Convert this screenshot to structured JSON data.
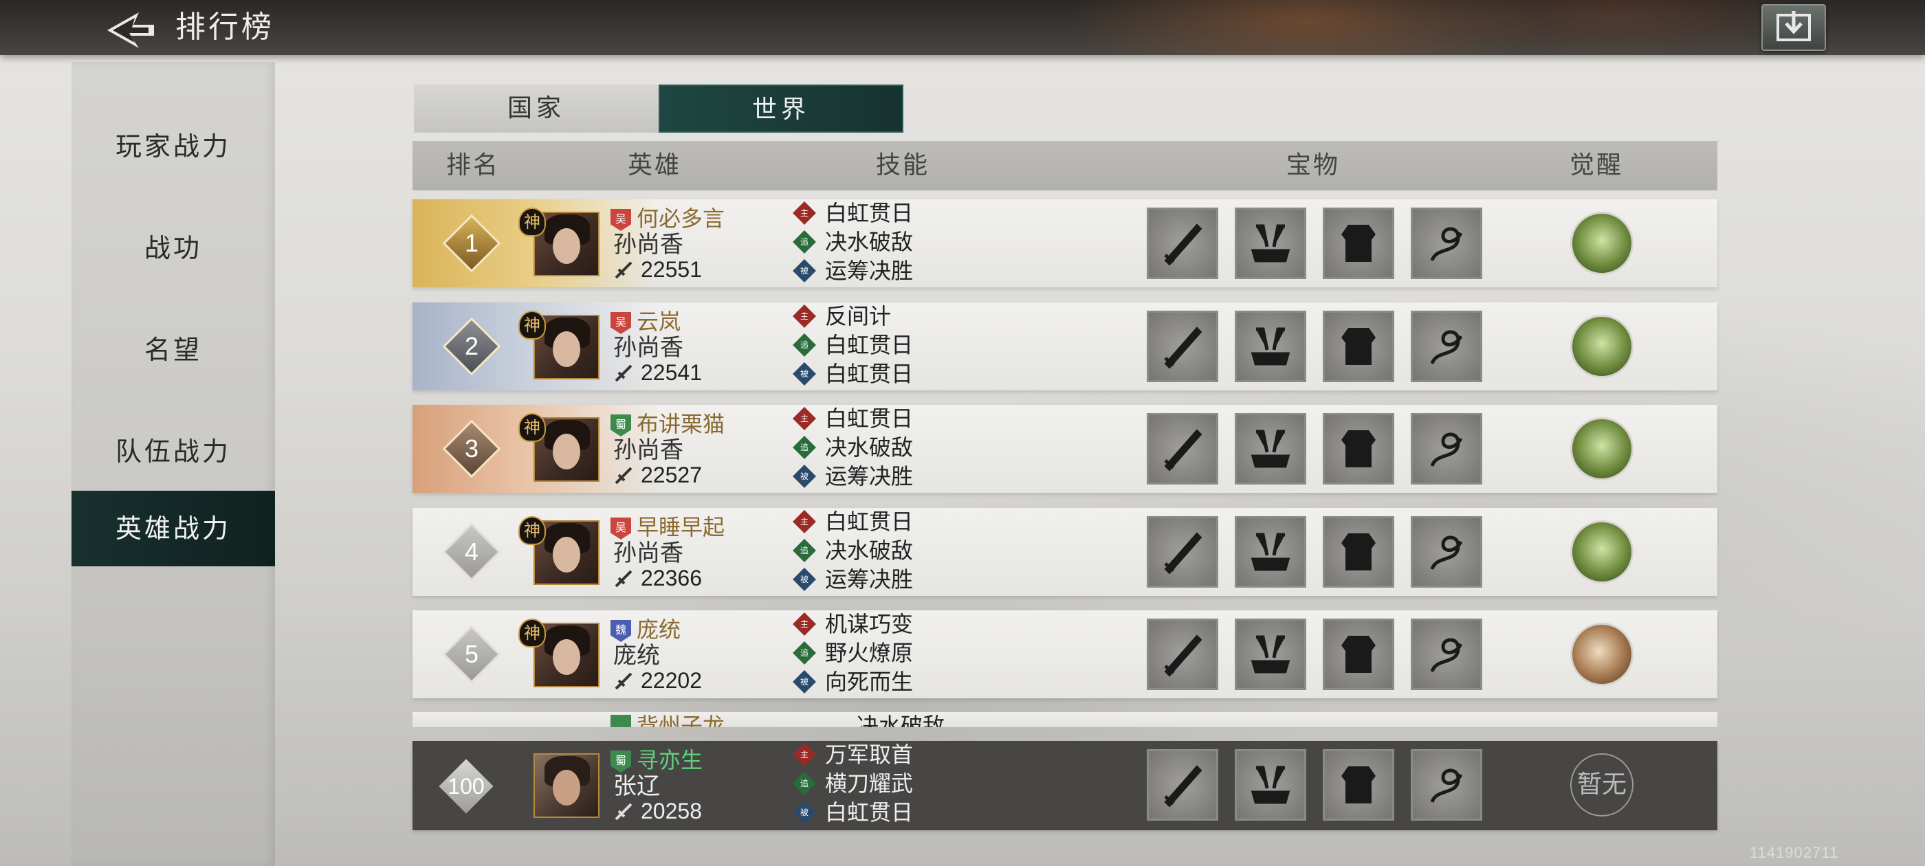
{
  "header": {
    "title": "排行榜",
    "back_icon": "back-arrow-icon",
    "export_icon": "share-export-icon"
  },
  "sidebar": {
    "items": [
      {
        "label": "玩家战力",
        "active": false
      },
      {
        "label": "战功",
        "active": false
      },
      {
        "label": "名望",
        "active": false
      },
      {
        "label": "队伍战力",
        "active": false
      },
      {
        "label": "英雄战力",
        "active": true
      }
    ]
  },
  "tabs": [
    {
      "label": "国家",
      "active": false
    },
    {
      "label": "世界",
      "active": true
    }
  ],
  "columns": {
    "rank": "排名",
    "hero": "英雄",
    "skills": "技能",
    "treasures": "宝物",
    "awaken": "觉醒"
  },
  "rows": [
    {
      "rank": "1",
      "god_badge": "神",
      "faction": "吴",
      "player": "何必多言",
      "hero": "孙尚香",
      "power": "22551",
      "skills": [
        {
          "tag": "主",
          "name": "白虹贯日"
        },
        {
          "tag": "追",
          "name": "决水破敌"
        },
        {
          "tag": "被",
          "name": "运筹决胜"
        }
      ]
    },
    {
      "rank": "2",
      "god_badge": "神",
      "faction": "吴",
      "player": "云岚",
      "hero": "孙尚香",
      "power": "22541",
      "skills": [
        {
          "tag": "主",
          "name": "反间计"
        },
        {
          "tag": "追",
          "name": "白虹贯日"
        },
        {
          "tag": "被",
          "name": "白虹贯日"
        }
      ]
    },
    {
      "rank": "3",
      "god_badge": "神",
      "faction": "蜀",
      "player": "布讲栗猫",
      "hero": "孙尚香",
      "power": "22527",
      "skills": [
        {
          "tag": "主",
          "name": "白虹贯日"
        },
        {
          "tag": "追",
          "name": "决水破敌"
        },
        {
          "tag": "被",
          "name": "运筹决胜"
        }
      ]
    },
    {
      "rank": "4",
      "god_badge": "神",
      "faction": "吴",
      "player": "早睡早起",
      "hero": "孙尚香",
      "power": "22366",
      "skills": [
        {
          "tag": "主",
          "name": "白虹贯日"
        },
        {
          "tag": "追",
          "name": "决水破敌"
        },
        {
          "tag": "被",
          "name": "运筹决胜"
        }
      ]
    },
    {
      "rank": "5",
      "god_badge": "神",
      "faction": "魏",
      "player": "庞统",
      "hero": "庞统",
      "power": "22202",
      "skills": [
        {
          "tag": "主",
          "name": "机谋巧变"
        },
        {
          "tag": "追",
          "name": "野火燎原"
        },
        {
          "tag": "被",
          "name": "向死而生"
        }
      ]
    }
  ],
  "partial_row": {
    "player": "背州子龙",
    "skill": "决水破敌"
  },
  "me": {
    "rank": "100",
    "faction": "蜀",
    "player": "寻亦生",
    "hero": "张辽",
    "power": "20258",
    "skills": [
      {
        "tag": "主",
        "name": "万军取首"
      },
      {
        "tag": "追",
        "name": "横刀耀武"
      },
      {
        "tag": "被",
        "name": "白虹贯日"
      }
    ],
    "awaken": "暂无"
  },
  "footer": {
    "uid": "1141902711"
  },
  "colors": {
    "accent": "#1f4642",
    "player_green": "#5ed27a",
    "wu": "#c9463d",
    "shu": "#3d8a4f",
    "wei": "#4a5fb0"
  }
}
